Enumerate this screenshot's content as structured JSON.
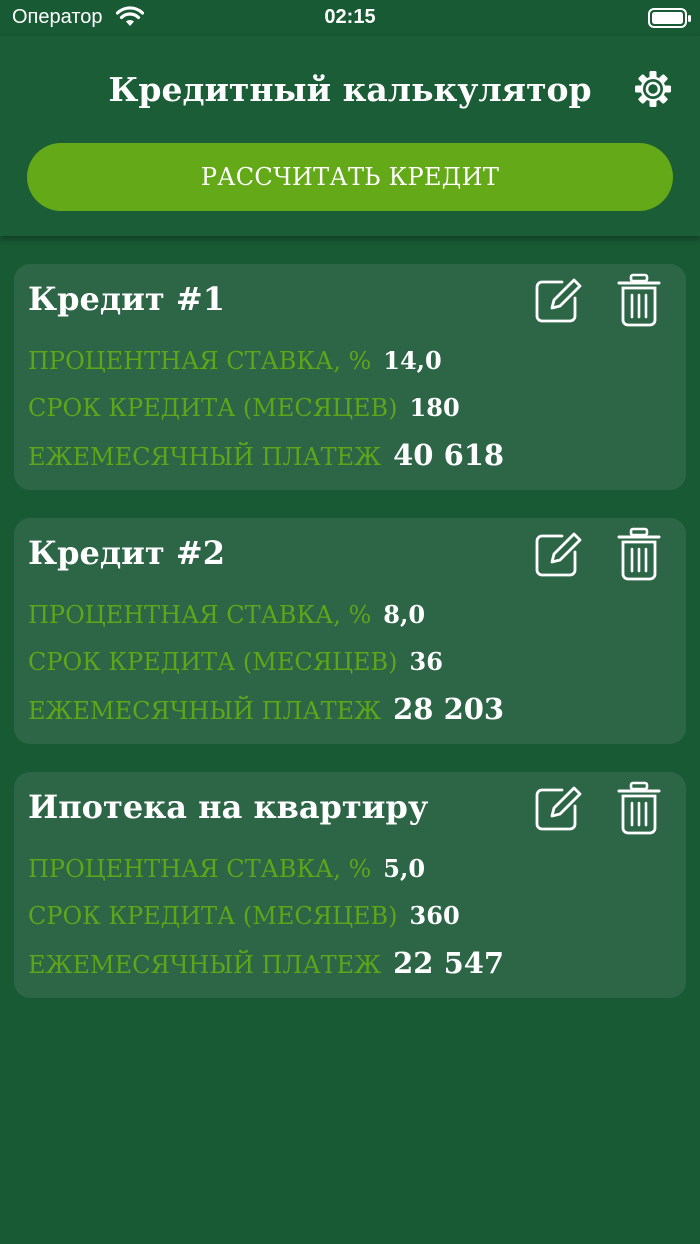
{
  "status_bar": {
    "carrier": "Оператор",
    "time": "02:15"
  },
  "header": {
    "title": "Кредитный калькулятор",
    "settings_icon": "gear-icon",
    "calculate_button": "РАССЧИТАТЬ КРЕДИТ"
  },
  "loans": [
    {
      "name": "Кредит #1",
      "rate_label": "ПРОЦЕНТНАЯ СТАВКА, %",
      "rate": "14,0",
      "term_label": "СРОК КРЕДИТА (МЕСЯЦЕВ)",
      "term": "180",
      "payment_label": "ЕЖЕМЕСЯЧНЫЙ ПЛАТЕЖ",
      "payment": "40 618"
    },
    {
      "name": "Кредит #2",
      "rate_label": "ПРОЦЕНТНАЯ СТАВКА, %",
      "rate": "8,0",
      "term_label": "СРОК КРЕДИТА (МЕСЯЦЕВ)",
      "term": "36",
      "payment_label": "ЕЖЕМЕСЯЧНЫЙ ПЛАТЕЖ",
      "payment": "28 203"
    },
    {
      "name": "Ипотека на квартиру",
      "rate_label": "ПРОЦЕНТНАЯ СТАВКА, %",
      "rate": "5,0",
      "term_label": "СРОК КРЕДИТА (МЕСЯЦЕВ)",
      "term": "360",
      "payment_label": "ЕЖЕМЕСЯЧНЫЙ ПЛАТЕЖ",
      "payment": "22 547"
    }
  ],
  "icons": {
    "edit": "edit-icon",
    "delete": "trash-icon"
  },
  "colors": {
    "background": "#185a34",
    "header": "#1a5d36",
    "card": "#2d6547",
    "accent_green": "#63a918",
    "label_green": "#5ea51a",
    "text": "#ffffff"
  }
}
